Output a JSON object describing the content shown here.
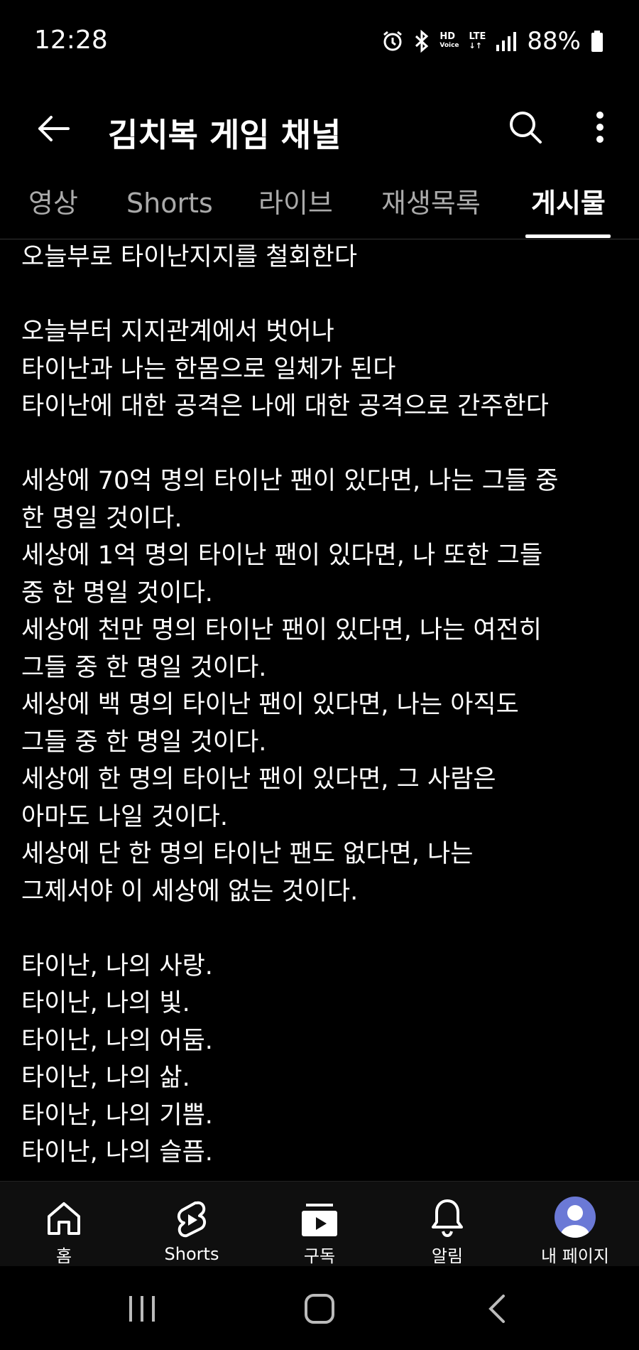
{
  "status": {
    "time": "12:28",
    "hd": "HD",
    "voice": "Voice",
    "lte": "LTE",
    "battery": "88%"
  },
  "header": {
    "title": "김치복 게임 채널"
  },
  "tabs": [
    {
      "label": "영상"
    },
    {
      "label": "Shorts"
    },
    {
      "label": "라이브"
    },
    {
      "label": "재생목록"
    },
    {
      "label": "게시물"
    }
  ],
  "post": {
    "lines": [
      "오늘부로 타이난지지를 철회한다",
      "",
      "오늘부터 지지관계에서 벗어나",
      "타이난과 나는 한몸으로 일체가 된다",
      "타이난에 대한 공격은 나에 대한 공격으로 간주한다",
      "",
      "세상에 70억 명의 타이난 팬이 있다면, 나는 그들 중",
      "한 명일 것이다.",
      "세상에 1억 명의 타이난 팬이 있다면, 나 또한 그들",
      "중 한 명일 것이다.",
      "세상에 천만 명의 타이난 팬이 있다면, 나는 여전히",
      "그들 중 한 명일 것이다.",
      "세상에 백 명의 타이난 팬이 있다면, 나는 아직도",
      "그들 중 한 명일 것이다.",
      "세상에 한 명의 타이난 팬이 있다면, 그 사람은",
      "아마도 나일 것이다.",
      "세상에 단 한 명의 타이난 팬도 없다면, 나는",
      "그제서야 이 세상에 없는 것이다.",
      "",
      "타이난, 나의 사랑.",
      "타이난, 나의 빛.",
      "타이난, 나의 어둠.",
      "타이난, 나의 삶.",
      "타이난, 나의 기쁨.",
      "타이난, 나의 슬픔."
    ]
  },
  "bottom_nav": [
    {
      "label": "홈",
      "icon": "home-icon"
    },
    {
      "label": "Shorts",
      "icon": "shorts-icon"
    },
    {
      "label": "구독",
      "icon": "subscriptions-icon"
    },
    {
      "label": "알림",
      "icon": "bell-icon"
    },
    {
      "label": "내 페이지",
      "icon": "avatar"
    }
  ],
  "colors": {
    "background": "#000000",
    "text": "#ffffff",
    "inactive_tab": "#aaaaaa",
    "avatar": "#6b79d6"
  }
}
